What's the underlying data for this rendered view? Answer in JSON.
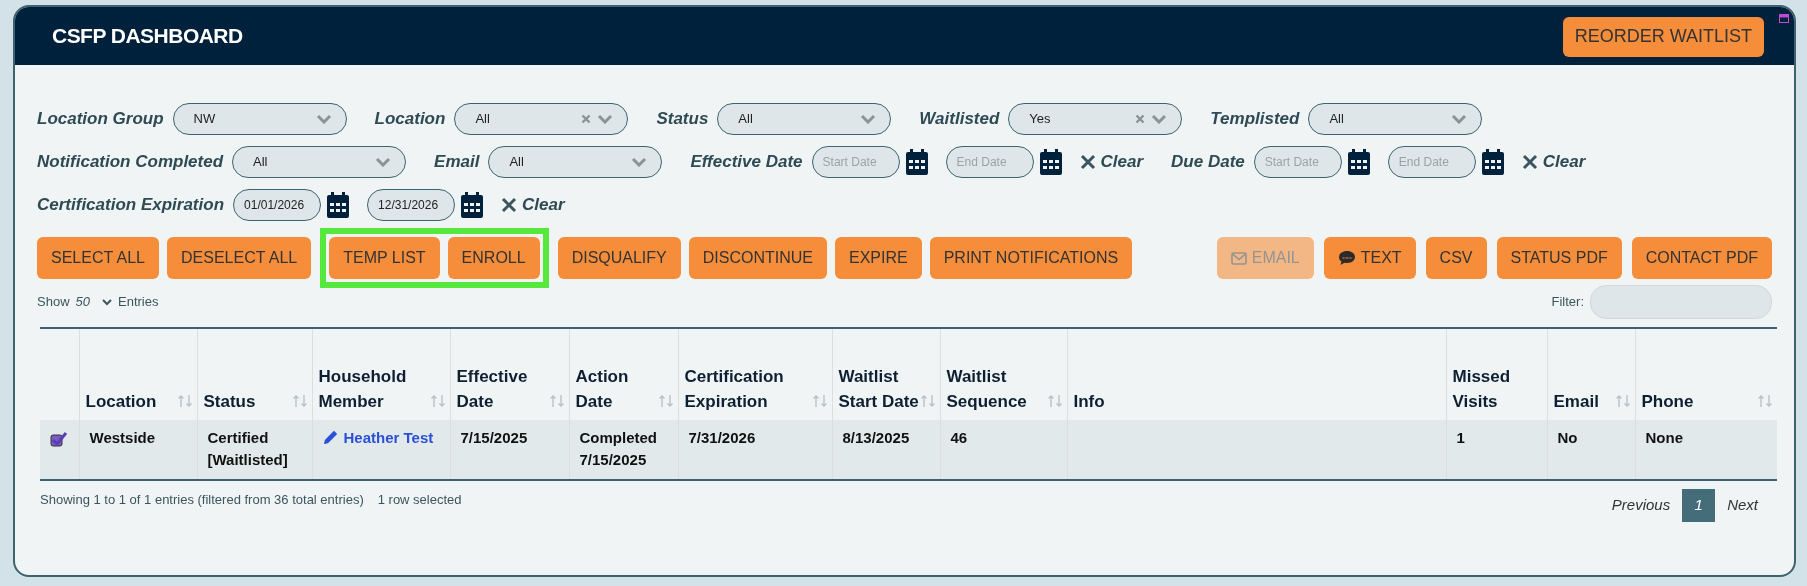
{
  "header": {
    "title": "CSFP DASHBOARD",
    "button": "REORDER WAITLIST"
  },
  "filters": [
    [
      {
        "kind": "select",
        "label": "Location Group",
        "value": "NW",
        "clearable": false
      },
      {
        "kind": "select",
        "label": "Location",
        "value": "All",
        "clearable": true
      },
      {
        "kind": "select",
        "label": "Status",
        "value": "All",
        "clearable": false
      },
      {
        "kind": "select",
        "label": "Waitlisted",
        "value": "Yes",
        "clearable": true
      },
      {
        "kind": "select",
        "label": "Templisted",
        "value": "All",
        "clearable": false
      }
    ],
    [
      {
        "kind": "select",
        "label": "Notification Completed",
        "value": "All",
        "clearable": false
      },
      {
        "kind": "select",
        "label": "Email",
        "value": "All",
        "clearable": false
      },
      {
        "kind": "daterange",
        "label": "Effective Date",
        "start": {
          "placeholder": "Start Date"
        },
        "end": {
          "placeholder": "End Date"
        },
        "clear": "Clear"
      },
      {
        "kind": "daterange",
        "label": "Due Date",
        "start": {
          "placeholder": "Start Date"
        },
        "end": {
          "placeholder": "End Date"
        },
        "clear": "Clear"
      }
    ],
    [
      {
        "kind": "daterange",
        "label": "Certification Expiration",
        "start": {
          "value": "01/01/2026"
        },
        "end": {
          "value": "12/31/2026"
        },
        "clear": "Clear"
      }
    ]
  ],
  "actions_left": [
    {
      "label": "SELECT ALL",
      "highlighted": false
    },
    {
      "label": "DESELECT ALL",
      "highlighted": false
    },
    {
      "label": "TEMP LIST",
      "highlighted": true
    },
    {
      "label": "ENROLL",
      "highlighted": true
    },
    {
      "label": "DISQUALIFY",
      "highlighted": false
    },
    {
      "label": "DISCONTINUE",
      "highlighted": false
    },
    {
      "label": "EXPIRE",
      "highlighted": false
    },
    {
      "label": "PRINT NOTIFICATIONS",
      "highlighted": false
    }
  ],
  "actions_right": [
    {
      "label": "EMAIL",
      "kind": "mail",
      "disabled": true
    },
    {
      "label": "TEXT",
      "kind": "message",
      "disabled": false
    },
    {
      "label": "CSV",
      "kind": "plain",
      "disabled": false
    },
    {
      "label": "STATUS PDF",
      "kind": "plain",
      "disabled": false
    },
    {
      "label": "CONTACT PDF",
      "kind": "plain",
      "disabled": false
    }
  ],
  "length": {
    "show": "Show",
    "value": "50",
    "entries": "Entries"
  },
  "filter": {
    "label": "Filter:"
  },
  "table": {
    "columns": [
      {
        "label": "Location",
        "sortable": true
      },
      {
        "label": "Status",
        "sortable": true
      },
      {
        "label": "Household Member",
        "sortable": true
      },
      {
        "label": "Effective Date",
        "sortable": true
      },
      {
        "label": "Action Date",
        "sortable": true
      },
      {
        "label": "Certification Expiration",
        "sortable": true
      },
      {
        "label": "Waitlist Start Date",
        "sortable": true
      },
      {
        "label": "Waitlist Sequence",
        "sortable": true
      },
      {
        "label": "Info",
        "sortable": false
      },
      {
        "label": "Missed Visits",
        "sortable": false
      },
      {
        "label": "Email",
        "sortable": true
      },
      {
        "label": "Phone",
        "sortable": true
      }
    ],
    "rows": [
      {
        "selected": true,
        "cells": [
          "Westside",
          "Certified [Waitlisted]",
          "Heather Test",
          "7/15/2025",
          "Completed 7/15/2025",
          "7/31/2026",
          "8/13/2025",
          "46",
          "",
          "1",
          "No",
          "None"
        ]
      }
    ]
  },
  "footer": {
    "info": "Showing 1 to 1 of 1 entries (filtered from 36 total entries)",
    "selection": "1 row selected",
    "previous": "Previous",
    "pages": [
      {
        "label": "1",
        "selected": true
      }
    ],
    "next": "Next"
  }
}
